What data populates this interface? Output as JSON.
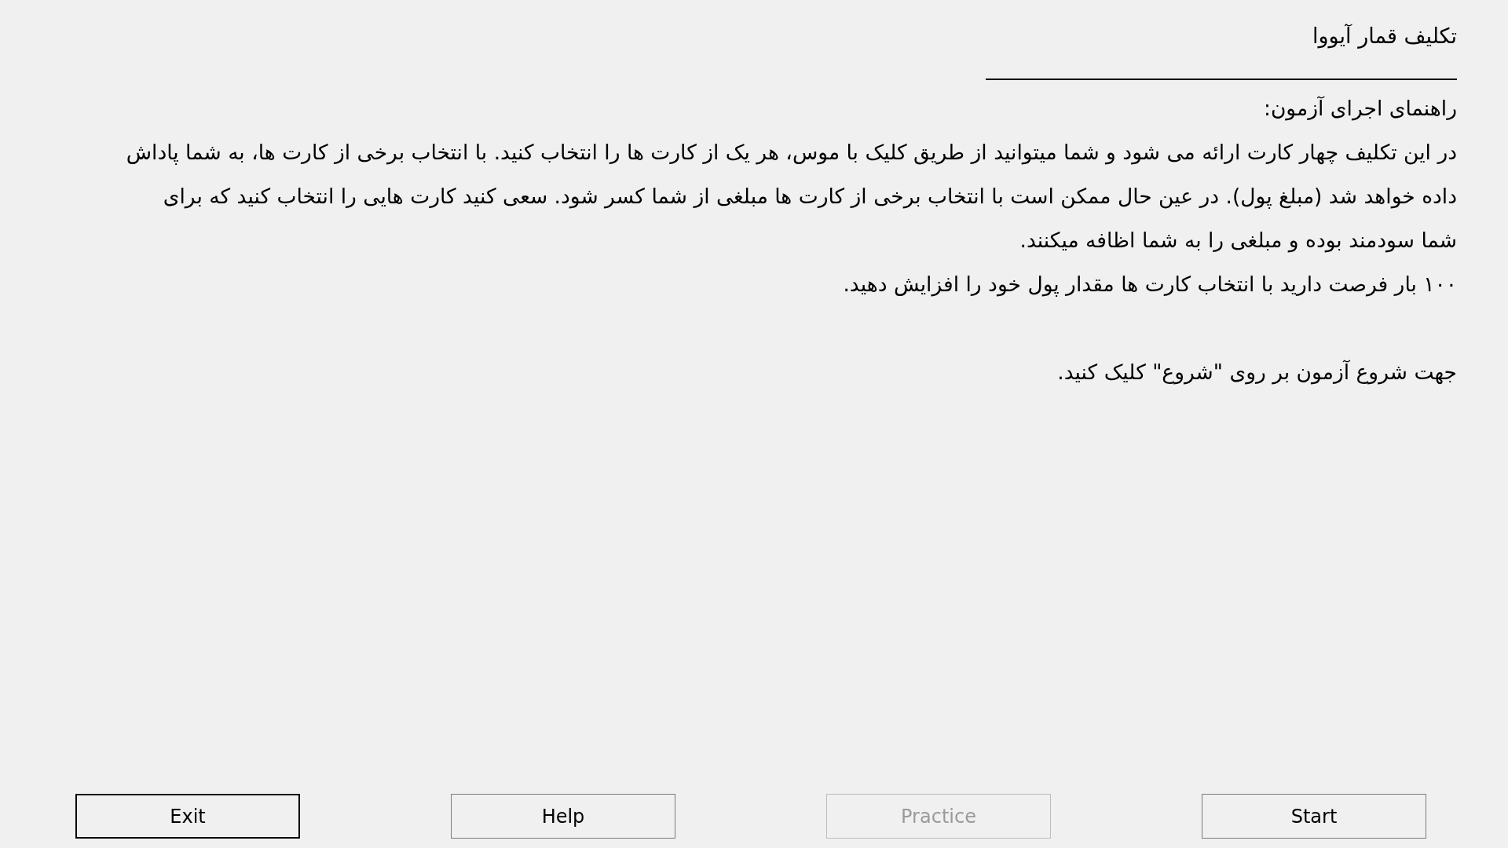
{
  "title": "تکلیف قمار آیووا",
  "instructions_heading": "راهنمای اجرای آزمون:",
  "instructions": [
    "در این تکلیف چهار کارت ارائه می شود و شما میتوانید از طریق کلیک با موس، هر یک از کارت ها را انتخاب کنید. با انتخاب برخی از کارت ها، به شما پاداش",
    "داده خواهد شد (مبلغ پول). در عین حال ممکن است با انتخاب برخی از کارت ها مبلغی از شما کسر شود. سعی کنید کارت هایی را انتخاب کنید که برای",
    "شما سودمند بوده و مبلغی را به شما اظافه میکنند.",
    "۱۰۰ بار فرصت دارید با انتخاب کارت ها مقدار پول خود را افزایش دهید."
  ],
  "start_prompt": "جهت شروع آزمون بر روی \"شروع\" کلیک کنید.",
  "buttons": [
    {
      "label": "Start",
      "default": false,
      "disabled": false
    },
    {
      "label": "Practice",
      "default": false,
      "disabled": true
    },
    {
      "label": "Help",
      "default": false,
      "disabled": false
    },
    {
      "label": "Exit",
      "default": true,
      "disabled": false
    }
  ]
}
